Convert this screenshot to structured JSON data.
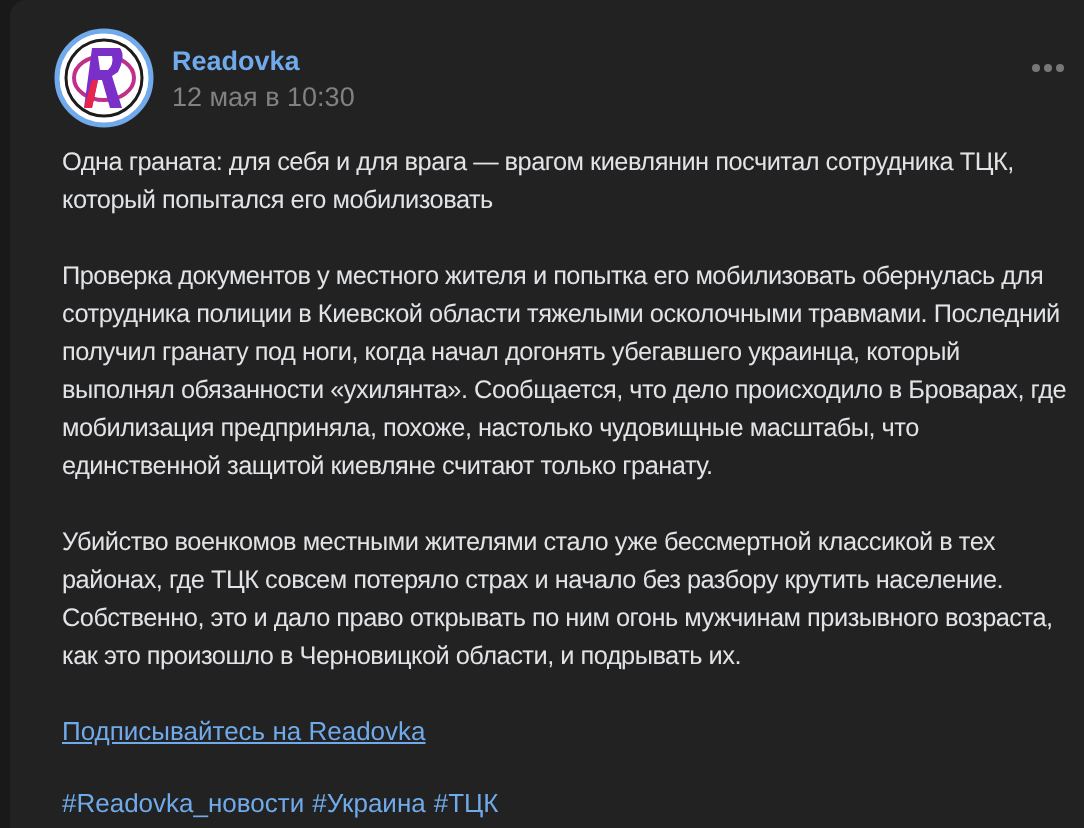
{
  "post": {
    "author": "Readovka",
    "date": "12 мая в 10:30",
    "paragraphs": [
      "Одна граната: для себя и для врага — врагом киевлянин посчитал сотрудника ТЦК, который попытался его мобилизовать",
      "Проверка документов у местного жителя и попытка его мобилизовать обернулась для сотрудника полиции в Киевской области тяжелыми осколочными травмами. Последний получил гранату под ноги, когда начал догонять убегавшего украинца, который выполнял обязанности «ухилянта». Сообщается, что дело происходило в Броварах, где мобилизация предприняла, похоже, настолько чудовищные масштабы, что единственной защитой киевляне считают только гранату.",
      "Убийство военкомов местными жителями стало уже бессмертной классикой в тех районах, где ТЦК совсем потеряло страх и начало без разбору крутить население. Собственно, это и дало право открывать по ним огонь мужчинам призывного возраста, как это произошло в Черновицкой области, и подрывать их."
    ],
    "link": "Подписывайтесь на Readovka",
    "hashtags": [
      "#Readovka_новости",
      "#Украина",
      "#ТЦК"
    ]
  }
}
